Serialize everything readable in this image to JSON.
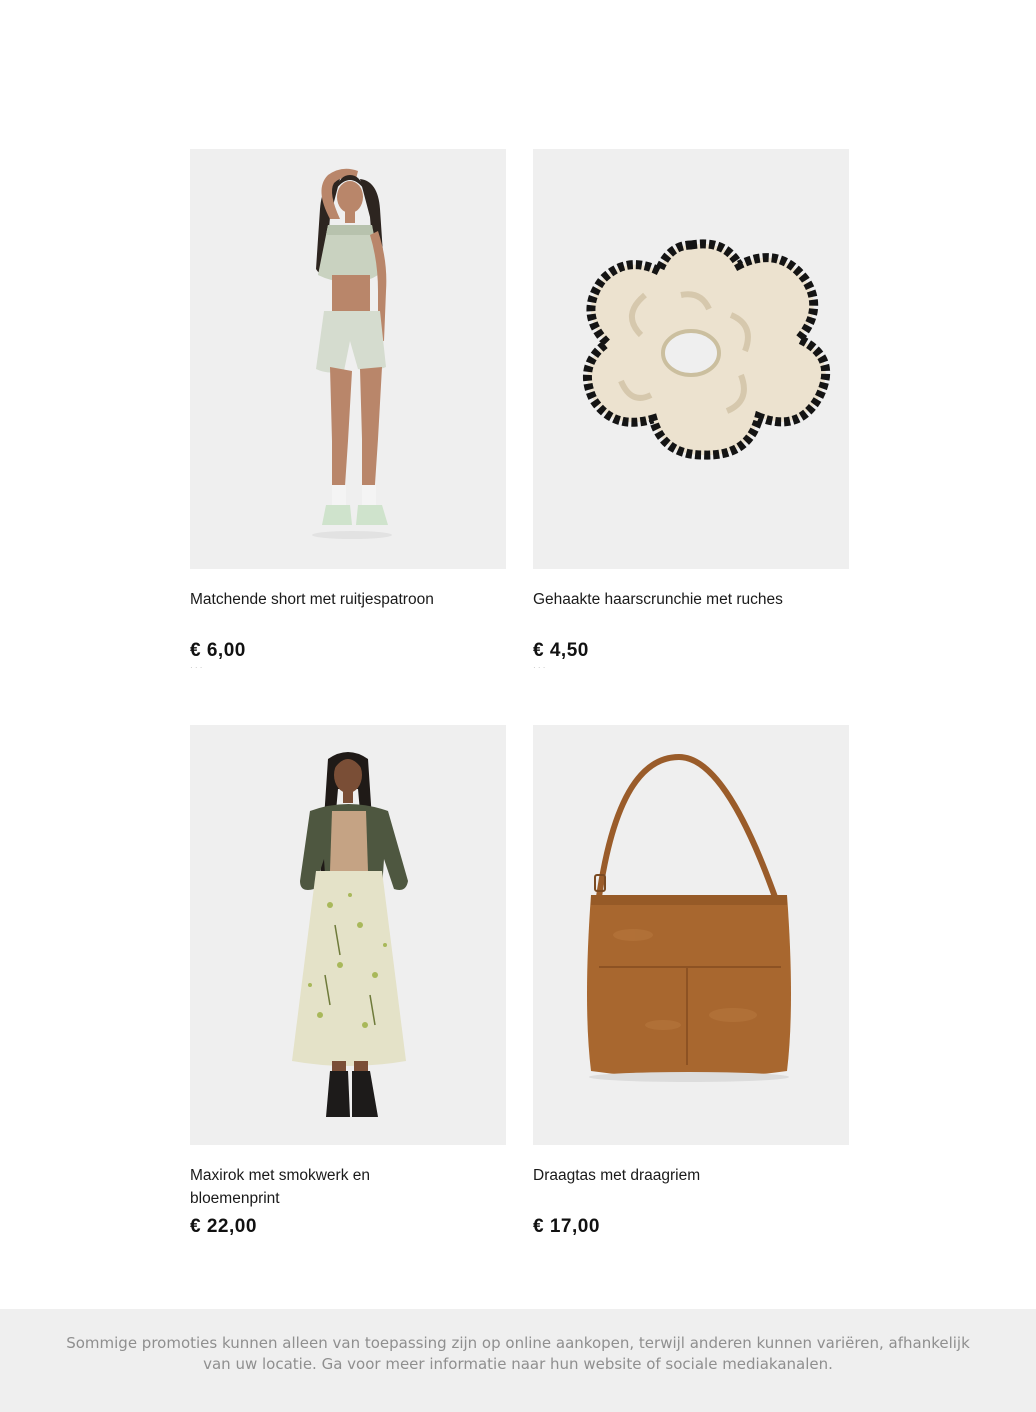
{
  "products": [
    {
      "title": "Matchende short met ruitjespatroon",
      "price": "€ 6,00",
      "image": "model-in-gingham-top-and-shorts"
    },
    {
      "title": "Gehaakte haarscrunchie met ruches",
      "price": "€ 4,50",
      "image": "crochet-ruffle-scrunchie"
    },
    {
      "title": "Maxirok met smokwerk en bloemenprint",
      "price": "€ 22,00",
      "image": "model-in-floral-maxi-skirt"
    },
    {
      "title": "Draagtas met draagriem",
      "price": "€ 17,00",
      "image": "suede-tote-bag"
    }
  ],
  "footer": {
    "disclaimer": "Sommige promoties kunnen alleen van toepassing zijn op online aankopen, terwijl anderen kunnen variëren, afhankelijk van uw locatie. Ga voor meer informatie naar hun website of sociale mediakanalen."
  },
  "colors": {
    "image_background": "#efefef",
    "footer_background": "#efefef",
    "footer_text": "#8f8f8f",
    "bag": "#a8672f"
  }
}
